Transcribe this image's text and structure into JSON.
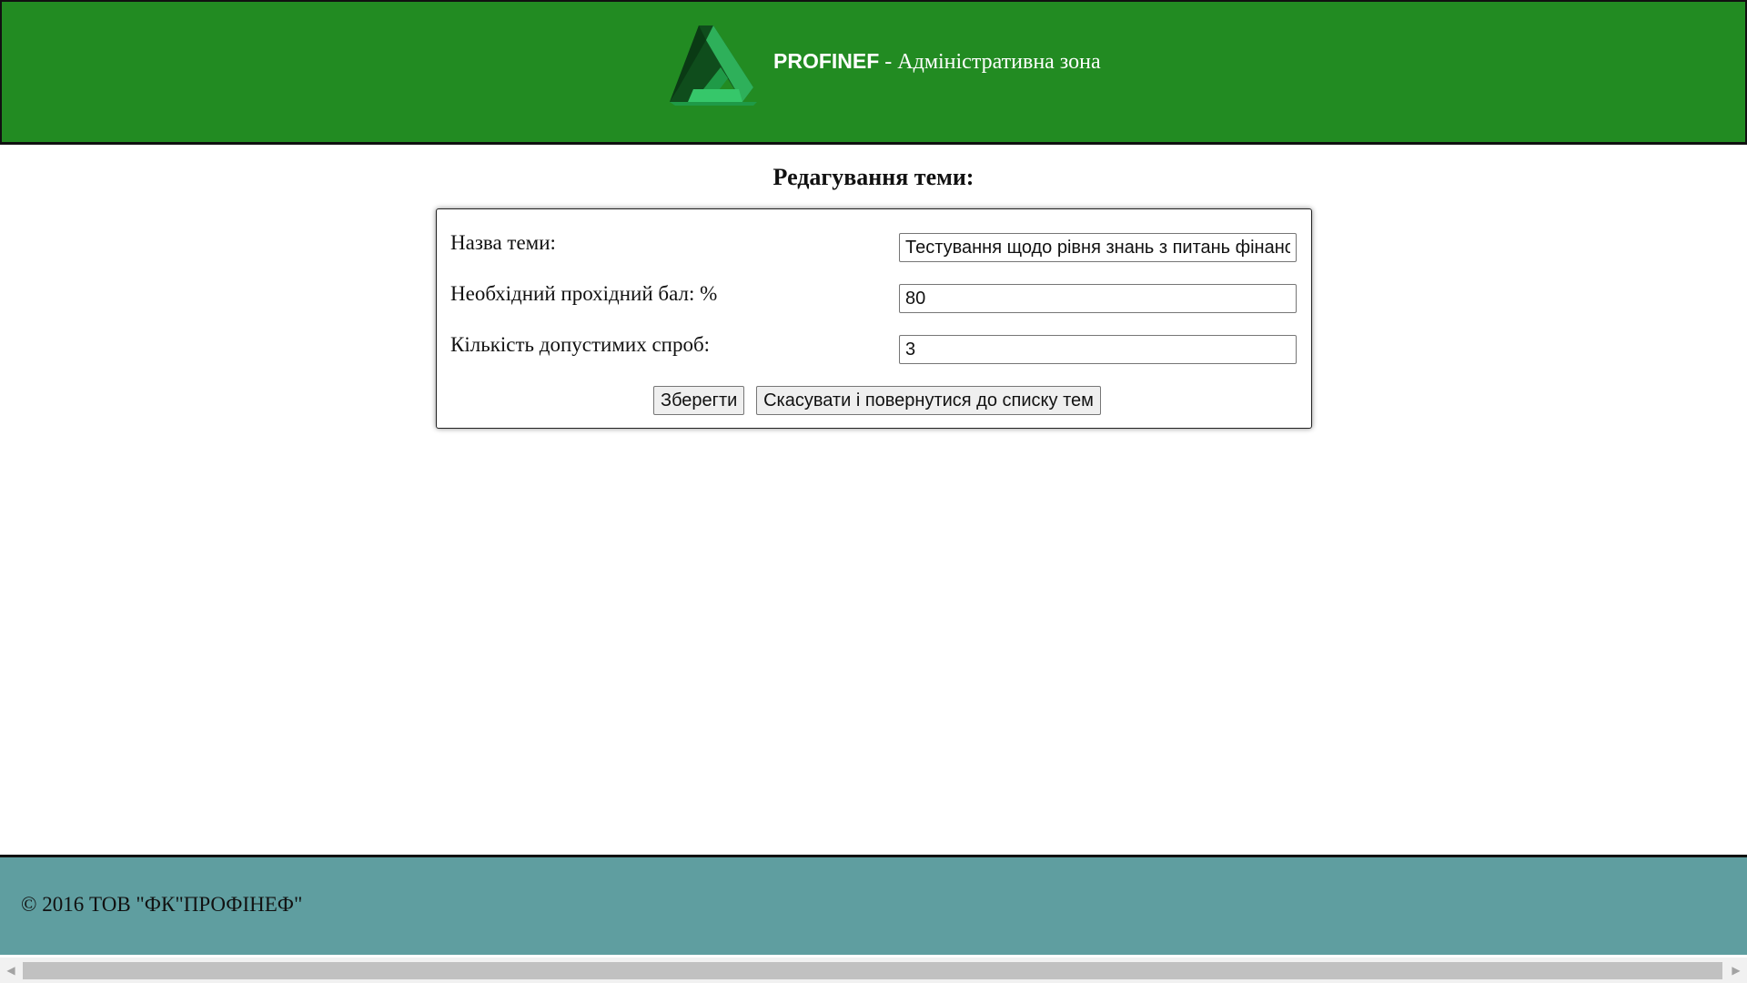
{
  "header": {
    "brand": "PROFINEF",
    "subtitle": " - Адміністративна зона",
    "logo_icon": "triangle-logo-icon",
    "colors": {
      "background": "#228b22",
      "logo_light": "#2eb05a",
      "logo_dark": "#0f4d1c"
    }
  },
  "page": {
    "title": "Редагування теми:"
  },
  "form": {
    "fields": [
      {
        "label": "Назва теми:",
        "value": "Тестування щодо рівня знань з питань фінансового моніторингу"
      },
      {
        "label": "Необхідний прохідний бал: %",
        "value": "80"
      },
      {
        "label": "Кількість допустимих спроб:",
        "value": "3"
      }
    ],
    "save_label": "Зберегти",
    "cancel_label": "Скасувати і повернутися до списку тем"
  },
  "footer": {
    "text": "© 2016 ТОВ \"ФК\"ПРОФІНЕФ\"",
    "color": "#5f9ea0"
  },
  "scrollbar": {
    "left_icon": "scroll-left-arrow-icon",
    "right_icon": "scroll-right-arrow-icon"
  }
}
